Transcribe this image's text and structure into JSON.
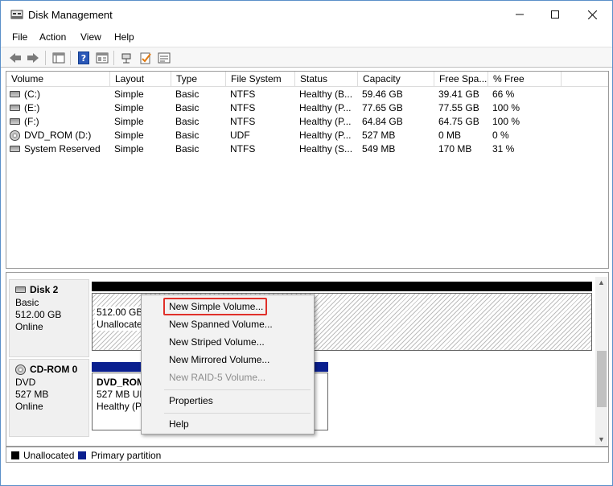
{
  "window": {
    "title": "Disk Management"
  },
  "menu": [
    "File",
    "Action",
    "View",
    "Help"
  ],
  "toolbar_icons": [
    "back-arrow-icon",
    "forward-arrow-icon",
    "disk-list-icon",
    "help-icon",
    "properties-icon",
    "connect-icon",
    "check-icon",
    "volume-icon"
  ],
  "volume_list": {
    "columns": [
      "Volume",
      "Layout",
      "Type",
      "File System",
      "Status",
      "Capacity",
      "Free Spa...",
      "% Free"
    ],
    "rows": [
      {
        "icon": "drive",
        "volume": "(C:)",
        "layout": "Simple",
        "type": "Basic",
        "fs": "NTFS",
        "status": "Healthy (B...",
        "capacity": "59.46 GB",
        "free": "39.41 GB",
        "pct": "66 %"
      },
      {
        "icon": "drive",
        "volume": "(E:)",
        "layout": "Simple",
        "type": "Basic",
        "fs": "NTFS",
        "status": "Healthy (P...",
        "capacity": "77.65 GB",
        "free": "77.55 GB",
        "pct": "100 %"
      },
      {
        "icon": "drive",
        "volume": "(F:)",
        "layout": "Simple",
        "type": "Basic",
        "fs": "NTFS",
        "status": "Healthy (P...",
        "capacity": "64.84 GB",
        "free": "64.75 GB",
        "pct": "100 %"
      },
      {
        "icon": "cd",
        "volume": "DVD_ROM (D:)",
        "layout": "Simple",
        "type": "Basic",
        "fs": "UDF",
        "status": "Healthy (P...",
        "capacity": "527 MB",
        "free": "0 MB",
        "pct": "0 %"
      },
      {
        "icon": "drive",
        "volume": "System Reserved",
        "layout": "Simple",
        "type": "Basic",
        "fs": "NTFS",
        "status": "Healthy (S...",
        "capacity": "549 MB",
        "free": "170 MB",
        "pct": "31 %"
      }
    ]
  },
  "disks": [
    {
      "name": "Disk 2",
      "type": "Basic",
      "size": "512.00 GB",
      "state": "Online",
      "partition_size": "512.00 GB",
      "partition_label": "Unallocate"
    },
    {
      "name": "CD-ROM 0",
      "type": "DVD",
      "size": "527 MB",
      "state": "Online",
      "partition_name": "DVD_ROM",
      "partition_size": "527 MB UD",
      "partition_status": "Healthy (P"
    }
  ],
  "legend": [
    {
      "label": "Unallocated",
      "color": "#000000"
    },
    {
      "label": "Primary partition",
      "color": "#0a1f8f"
    }
  ],
  "context_menu": {
    "items": [
      {
        "label": "New Simple Volume...",
        "enabled": true,
        "highlighted": true
      },
      {
        "label": "New Spanned Volume...",
        "enabled": true
      },
      {
        "label": "New Striped Volume...",
        "enabled": true
      },
      {
        "label": "New Mirrored Volume...",
        "enabled": true
      },
      {
        "label": "New RAID-5 Volume...",
        "enabled": false
      },
      {
        "label": "Properties",
        "enabled": true
      },
      {
        "label": "Help",
        "enabled": true
      }
    ]
  },
  "colors": {
    "highlight_box": "#e0302a",
    "primary_partition": "#0a1f8f",
    "unallocated": "#000000"
  }
}
